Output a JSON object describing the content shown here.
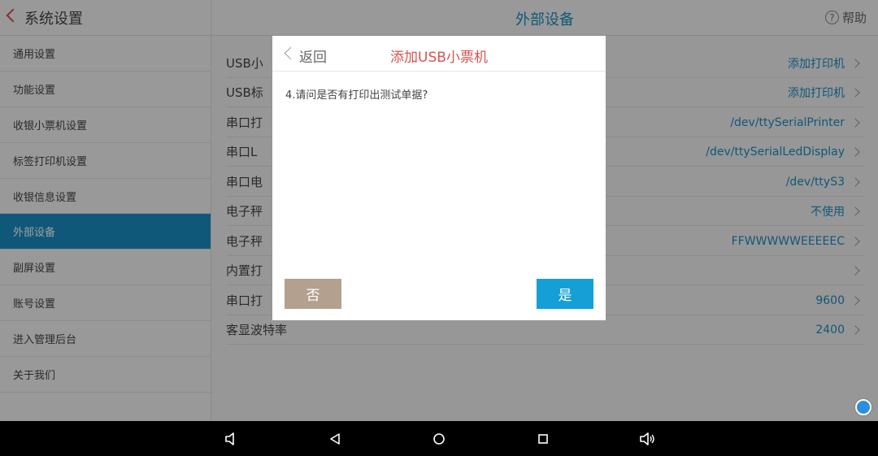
{
  "header": {
    "sys_title": "系统设置",
    "page_title": "外部设备",
    "help_label": "帮助",
    "help_icon": "?"
  },
  "sidebar": {
    "items": [
      {
        "label": "通用设置",
        "active": false
      },
      {
        "label": "功能设置",
        "active": false
      },
      {
        "label": "收银小票机设置",
        "active": false
      },
      {
        "label": "标签打印机设置",
        "active": false
      },
      {
        "label": "收银信息设置",
        "active": false
      },
      {
        "label": "外部设备",
        "active": true
      },
      {
        "label": "副屏设置",
        "active": false
      },
      {
        "label": "账号设置",
        "active": false
      },
      {
        "label": "进入管理后台",
        "active": false
      },
      {
        "label": "关于我们",
        "active": false
      }
    ]
  },
  "main": {
    "rows": [
      {
        "label": "USB小",
        "value": "添加打印机"
      },
      {
        "label": "USB标",
        "value": "添加打印机"
      },
      {
        "label": "串口打",
        "value": "/dev/ttySerialPrinter"
      },
      {
        "label": "串口L",
        "value": "/dev/ttySerialLedDisplay"
      },
      {
        "label": "串口电",
        "value": "/dev/ttyS3"
      },
      {
        "label": "电子秤",
        "value": "不使用"
      },
      {
        "label": "电子秤",
        "value": "FFWWWWWEEEEEC"
      },
      {
        "label": "内置打",
        "value": ""
      },
      {
        "label": "串口打",
        "value": "9600"
      },
      {
        "label": "客显波特率",
        "value": "2400"
      }
    ]
  },
  "dialog": {
    "back_label": "返回",
    "title": "添加USB小票机",
    "question": "4.请问是否有打印出测试单据?",
    "no_label": "否",
    "yes_label": "是"
  },
  "colors": {
    "accent": "#1a8fc4",
    "dialog_title": "#d9534f",
    "no_button": "#b3a08f",
    "yes_button": "#14a0d6"
  },
  "navbar": {
    "icons": [
      "volume-down-icon",
      "back-icon",
      "home-icon",
      "recents-icon",
      "volume-up-icon"
    ]
  }
}
